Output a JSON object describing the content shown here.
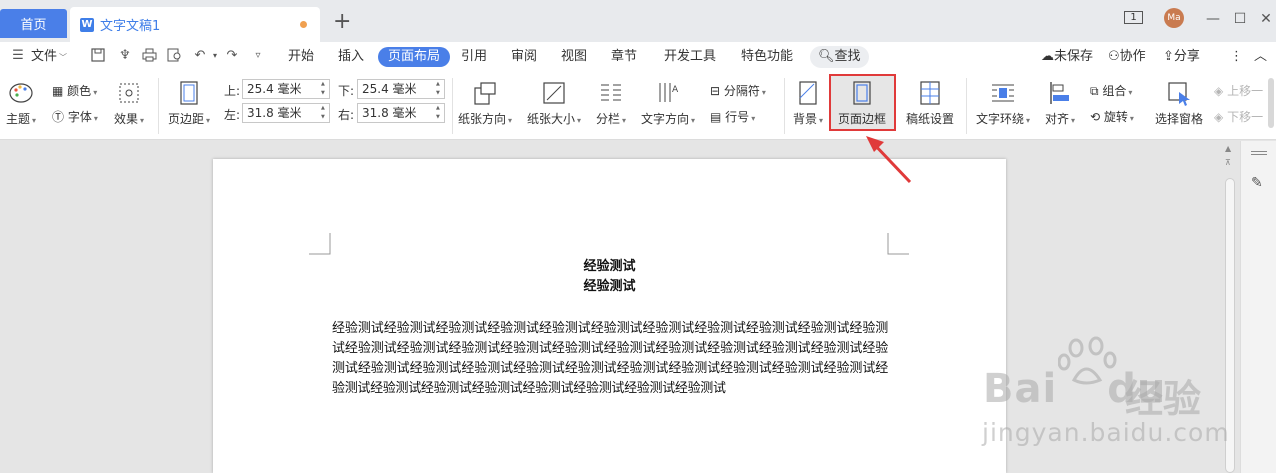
{
  "tabs": {
    "home": "首页",
    "doc_icon": "W",
    "doc_title": "文字文稿1",
    "add": "+"
  },
  "window": {
    "tab_count": "1",
    "avatar": "Ma",
    "minimize": "—",
    "restore": "☐",
    "close": "✕"
  },
  "menu": {
    "file": "文件",
    "items": [
      "开始",
      "插入",
      "页面布局",
      "引用",
      "审阅",
      "视图",
      "章节",
      "开发工具",
      "特色功能"
    ],
    "active": "页面布局",
    "search": "查找",
    "unsaved": "未保存",
    "collab": "协作",
    "share": "分享"
  },
  "ribbon": {
    "theme": "主题",
    "color": "颜色",
    "font": "字体",
    "effect": "效果",
    "margin": "页边距",
    "top_label": "上:",
    "top_value": "25.4 毫米",
    "bottom_label": "下:",
    "bottom_value": "25.4 毫米",
    "left_label": "左:",
    "left_value": "31.8 毫米",
    "right_label": "右:",
    "right_value": "31.8 毫米",
    "orientation": "纸张方向",
    "size": "纸张大小",
    "columns": "分栏",
    "text_direction": "文字方向",
    "breaks": "分隔符",
    "line_numbers": "行号",
    "background": "背景",
    "page_border": "页面边框",
    "draft_setup": "稿纸设置",
    "text_wrap": "文字环绕",
    "align": "对齐",
    "group": "组合",
    "rotate": "旋转",
    "selection_pane": "选择窗格",
    "bring_forward": "上移一",
    "send_backward": "下移一"
  },
  "document": {
    "heading1": "经验测试",
    "heading2": "经验测试",
    "body": "经验测试经验测试经验测试经验测试经验测试经验测试经验测试经验测试经验测试经验测试经验测试经验测试经验测试经验测试经验测试经验测试经验测试经验测试经验测试经验测试经验测试经验测试经验测试经验测试经验测试经验测试经验测试经验测试经验测试经验测试经验测试经验测试经验测试经验测试经验测试经验测试经验测试经验测试经验测试经验测试"
  },
  "watermark": {
    "brand_left": "Bai",
    "brand_right": "du",
    "brand_cn": "经验",
    "url": "jingyan.baidu.com"
  },
  "colors": {
    "accent": "#4a7fe8",
    "highlight": "#e03a3a"
  }
}
